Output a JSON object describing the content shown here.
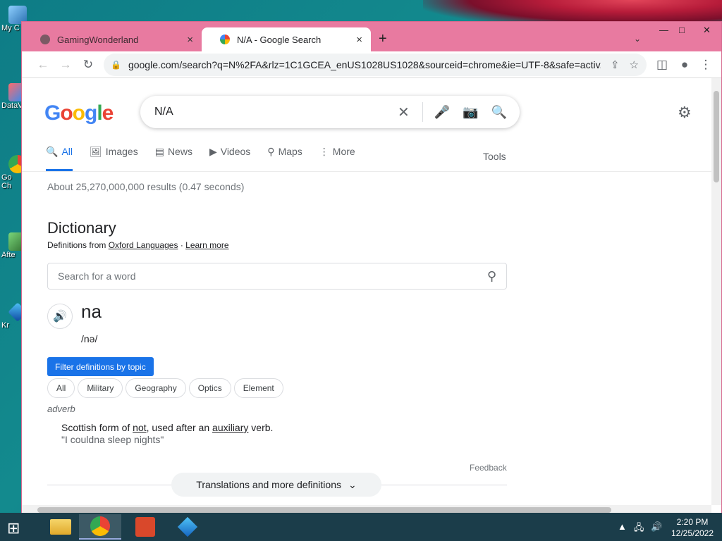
{
  "desktop": {
    "icons": [
      {
        "label": "My C"
      },
      {
        "label": "DataV"
      },
      {
        "label": "Go"
      },
      {
        "label": "Ch"
      },
      {
        "label": "Afte"
      },
      {
        "label": "Kr"
      }
    ]
  },
  "browser": {
    "tabs": [
      {
        "title": "GamingWonderland",
        "close": "×"
      },
      {
        "title": "N/A - Google Search",
        "close": "×"
      }
    ],
    "new_tab": "+",
    "tab_menu": "⌄",
    "window_buttons": {
      "minimize": "—",
      "maximize": "□",
      "close": "✕"
    },
    "url": "google.com/search?q=N%2FA&rlz=1C1GCEA_enUS1028US1028&sourceid=chrome&ie=UTF-8&safe=activ..."
  },
  "google": {
    "logo": "Google",
    "query": "N/A",
    "nav": [
      {
        "icon": "🔍",
        "label": "All"
      },
      {
        "icon": "🖼",
        "label": "Images"
      },
      {
        "icon": "▤",
        "label": "News"
      },
      {
        "icon": "▶",
        "label": "Videos"
      },
      {
        "icon": "⚲",
        "label": "Maps"
      },
      {
        "icon": "⋮",
        "label": "More"
      }
    ],
    "tools": "Tools",
    "stats": "About 25,270,000,000 results (0.47 seconds)"
  },
  "dictionary": {
    "title": "Dictionary",
    "sub_prefix": "Definitions from",
    "source": "Oxford Languages",
    "sep": "·",
    "learn_more": "Learn more",
    "word_search_placeholder": "Search for a word",
    "headword": "na",
    "phonetic": "/nə/",
    "filter_label": "Filter definitions by topic",
    "chips": [
      "All",
      "Military",
      "Geography",
      "Optics",
      "Element"
    ],
    "part_of_speech": "adverb",
    "definition": {
      "prefix": "Scottish form of ",
      "link1": "not",
      "middle": ", used after an ",
      "link2": "auxiliary",
      "suffix": " verb."
    },
    "example": "\"I couldna sleep nights\"",
    "feedback": "Feedback",
    "more_button": "Translations and more definitions"
  },
  "taskbar": {
    "time": "2:20 PM",
    "date": "12/25/2022"
  }
}
